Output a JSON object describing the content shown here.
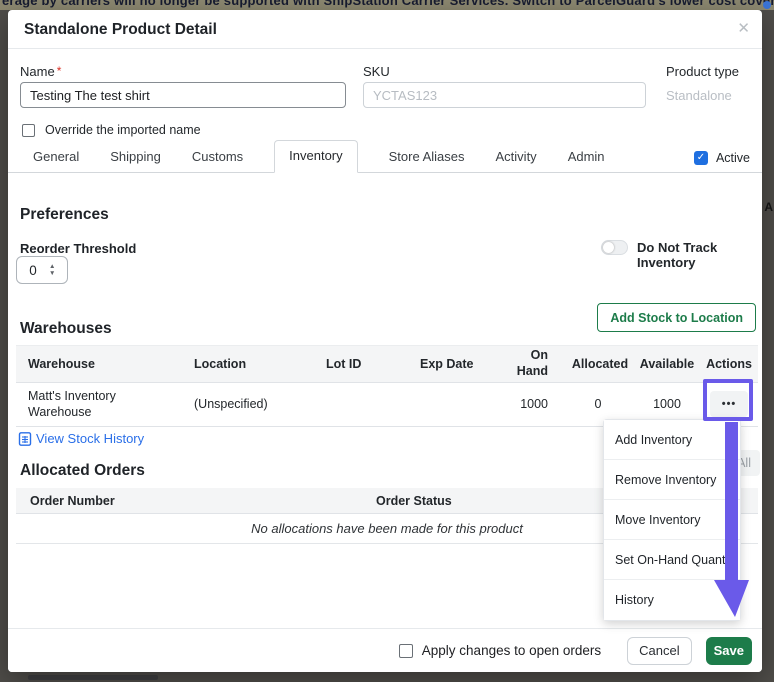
{
  "page_background": {
    "banner_text": "erage by carriers will no longer be supported with ShipStation Carrier Services. Switch to ParcelGuard's lower cost coverage in one click.",
    "edge_text_fragment": "A"
  },
  "modal": {
    "title": "Standalone Product Detail",
    "close_icon": "✕"
  },
  "form": {
    "name": {
      "label": "Name",
      "required_mark": "*",
      "value": "Testing The test shirt"
    },
    "sku": {
      "label": "SKU",
      "placeholder": "YCTAS123"
    },
    "product_type": {
      "label": "Product type",
      "value": "Standalone"
    },
    "override_checkbox_label": "Override the imported name"
  },
  "tabs": {
    "items": [
      {
        "label": "General",
        "active": false
      },
      {
        "label": "Shipping",
        "active": false
      },
      {
        "label": "Customs",
        "active": false
      },
      {
        "label": "Inventory",
        "active": true
      },
      {
        "label": "Store Aliases",
        "active": false
      },
      {
        "label": "Activity",
        "active": false
      },
      {
        "label": "Admin",
        "active": false
      }
    ],
    "active_checkbox": {
      "label": "Active",
      "checked": true,
      "check_glyph": "✓"
    }
  },
  "preferences": {
    "heading": "Preferences",
    "reorder_threshold": {
      "label": "Reorder Threshold",
      "value": "0",
      "up_glyph": "▲",
      "down_glyph": "▼"
    },
    "do_not_track": {
      "label": "Do Not Track Inventory",
      "enabled": false
    }
  },
  "warehouses": {
    "heading": "Warehouses",
    "add_stock_button": "Add Stock to Location",
    "table": {
      "columns": [
        "Warehouse",
        "Location",
        "Lot ID",
        "Exp Date",
        "On Hand",
        "Allocated",
        "Available",
        "Actions"
      ],
      "rows": [
        {
          "warehouse": "Matt's Inventory Warehouse",
          "location": "(Unspecified)",
          "lot_id": "",
          "exp_date": "",
          "on_hand": "1000",
          "allocated": "0",
          "available": "1000",
          "actions_icon": "•••"
        }
      ]
    },
    "view_stock_history_link": "View Stock History",
    "show_all_button_partial": "All"
  },
  "allocated_orders": {
    "heading": "Allocated Orders",
    "columns": [
      "Order Number",
      "Order Status"
    ],
    "empty_message": "No allocations have been made for this product"
  },
  "actions_menu": {
    "items": [
      "Add Inventory",
      "Remove Inventory",
      "Move Inventory",
      "Set On-Hand Quantity",
      "History"
    ]
  },
  "footer": {
    "apply_checkbox_label": "Apply changes to open orders",
    "cancel_label": "Cancel",
    "save_label": "Save"
  },
  "colors": {
    "accent_green": "#1d7c4a",
    "link_blue": "#2a6fe8",
    "checkbox_blue": "#1f6fe0",
    "annotation_purple": "#6a5ae9"
  }
}
